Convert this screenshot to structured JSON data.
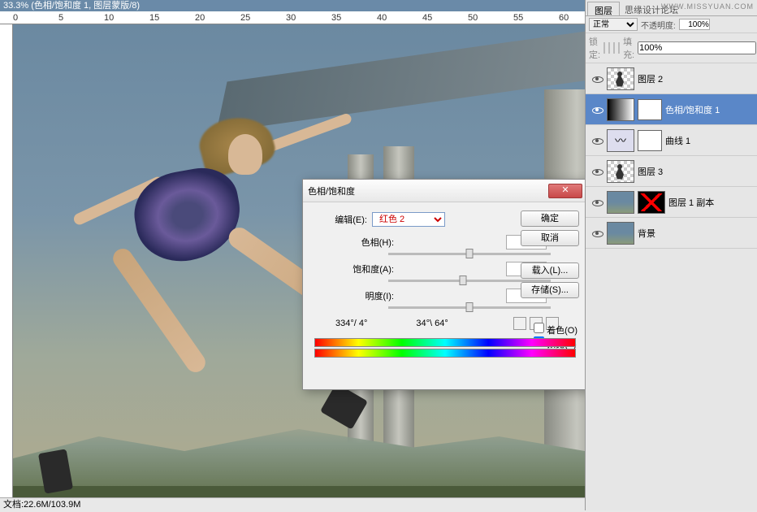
{
  "topbar": {
    "title": "33.3% (色相/饱和度 1, 图层蒙版/8)"
  },
  "statusbar": {
    "text": "文档:22.6M/103.9M"
  },
  "watermark": "WWW.MISSYUAN.COM",
  "ruler_ticks": [
    "0",
    "5",
    "10",
    "15",
    "20",
    "25",
    "30",
    "35",
    "40",
    "45",
    "50",
    "55",
    "60"
  ],
  "dialog": {
    "title": "色相/饱和度",
    "edit_label": "编辑(E):",
    "edit_value": "红色 2",
    "hue_label": "色相(H):",
    "hue_value": "0",
    "sat_label": "饱和度(A):",
    "sat_value": "-7",
    "light_label": "明度(I):",
    "light_value": "0",
    "angle_left": "334°/ 4°",
    "angle_right": "34°\\ 64°",
    "btn_ok": "确定",
    "btn_cancel": "取消",
    "btn_load": "载入(L)...",
    "btn_save": "存储(S)...",
    "chk_colorize": "着色(O)",
    "chk_preview": "预览(P)"
  },
  "panel": {
    "tab": "图层",
    "brand": "思缘设计论坛",
    "blend": "正常",
    "opacity_label": "不透明度:",
    "opacity_value": "100%",
    "lock_label": "锁定:",
    "fill_label": "填充:",
    "fill_value": "100%",
    "layers": [
      {
        "name": "图层 2"
      },
      {
        "name": "色相/饱和度 1"
      },
      {
        "name": "曲线 1"
      },
      {
        "name": "图层 3"
      },
      {
        "name": "图层 1 副本"
      },
      {
        "name": "背景"
      }
    ]
  }
}
